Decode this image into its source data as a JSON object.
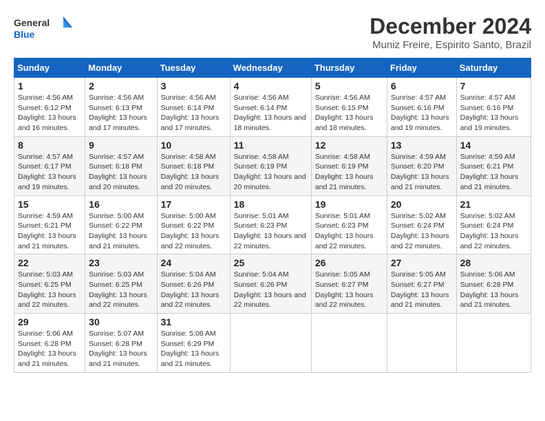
{
  "logo": {
    "line1": "General",
    "line2": "Blue"
  },
  "title": "December 2024",
  "subtitle": "Muniz Freire, Espirito Santo, Brazil",
  "days_of_week": [
    "Sunday",
    "Monday",
    "Tuesday",
    "Wednesday",
    "Thursday",
    "Friday",
    "Saturday"
  ],
  "weeks": [
    [
      {
        "day": "1",
        "sunrise": "4:56 AM",
        "sunset": "6:12 PM",
        "daylight": "13 hours and 16 minutes."
      },
      {
        "day": "2",
        "sunrise": "4:56 AM",
        "sunset": "6:13 PM",
        "daylight": "13 hours and 17 minutes."
      },
      {
        "day": "3",
        "sunrise": "4:56 AM",
        "sunset": "6:14 PM",
        "daylight": "13 hours and 17 minutes."
      },
      {
        "day": "4",
        "sunrise": "4:56 AM",
        "sunset": "6:14 PM",
        "daylight": "13 hours and 18 minutes."
      },
      {
        "day": "5",
        "sunrise": "4:56 AM",
        "sunset": "6:15 PM",
        "daylight": "13 hours and 18 minutes."
      },
      {
        "day": "6",
        "sunrise": "4:57 AM",
        "sunset": "6:16 PM",
        "daylight": "13 hours and 19 minutes."
      },
      {
        "day": "7",
        "sunrise": "4:57 AM",
        "sunset": "6:16 PM",
        "daylight": "13 hours and 19 minutes."
      }
    ],
    [
      {
        "day": "8",
        "sunrise": "4:57 AM",
        "sunset": "6:17 PM",
        "daylight": "13 hours and 19 minutes."
      },
      {
        "day": "9",
        "sunrise": "4:57 AM",
        "sunset": "6:18 PM",
        "daylight": "13 hours and 20 minutes."
      },
      {
        "day": "10",
        "sunrise": "4:58 AM",
        "sunset": "6:18 PM",
        "daylight": "13 hours and 20 minutes."
      },
      {
        "day": "11",
        "sunrise": "4:58 AM",
        "sunset": "6:19 PM",
        "daylight": "13 hours and 20 minutes."
      },
      {
        "day": "12",
        "sunrise": "4:58 AM",
        "sunset": "6:19 PM",
        "daylight": "13 hours and 21 minutes."
      },
      {
        "day": "13",
        "sunrise": "4:59 AM",
        "sunset": "6:20 PM",
        "daylight": "13 hours and 21 minutes."
      },
      {
        "day": "14",
        "sunrise": "4:59 AM",
        "sunset": "6:21 PM",
        "daylight": "13 hours and 21 minutes."
      }
    ],
    [
      {
        "day": "15",
        "sunrise": "4:59 AM",
        "sunset": "6:21 PM",
        "daylight": "13 hours and 21 minutes."
      },
      {
        "day": "16",
        "sunrise": "5:00 AM",
        "sunset": "6:22 PM",
        "daylight": "13 hours and 21 minutes."
      },
      {
        "day": "17",
        "sunrise": "5:00 AM",
        "sunset": "6:22 PM",
        "daylight": "13 hours and 22 minutes."
      },
      {
        "day": "18",
        "sunrise": "5:01 AM",
        "sunset": "6:23 PM",
        "daylight": "13 hours and 22 minutes."
      },
      {
        "day": "19",
        "sunrise": "5:01 AM",
        "sunset": "6:23 PM",
        "daylight": "13 hours and 22 minutes."
      },
      {
        "day": "20",
        "sunrise": "5:02 AM",
        "sunset": "6:24 PM",
        "daylight": "13 hours and 22 minutes."
      },
      {
        "day": "21",
        "sunrise": "5:02 AM",
        "sunset": "6:24 PM",
        "daylight": "13 hours and 22 minutes."
      }
    ],
    [
      {
        "day": "22",
        "sunrise": "5:03 AM",
        "sunset": "6:25 PM",
        "daylight": "13 hours and 22 minutes."
      },
      {
        "day": "23",
        "sunrise": "5:03 AM",
        "sunset": "6:25 PM",
        "daylight": "13 hours and 22 minutes."
      },
      {
        "day": "24",
        "sunrise": "5:04 AM",
        "sunset": "6:26 PM",
        "daylight": "13 hours and 22 minutes."
      },
      {
        "day": "25",
        "sunrise": "5:04 AM",
        "sunset": "6:26 PM",
        "daylight": "13 hours and 22 minutes."
      },
      {
        "day": "26",
        "sunrise": "5:05 AM",
        "sunset": "6:27 PM",
        "daylight": "13 hours and 22 minutes."
      },
      {
        "day": "27",
        "sunrise": "5:05 AM",
        "sunset": "6:27 PM",
        "daylight": "13 hours and 21 minutes."
      },
      {
        "day": "28",
        "sunrise": "5:06 AM",
        "sunset": "6:28 PM",
        "daylight": "13 hours and 21 minutes."
      }
    ],
    [
      {
        "day": "29",
        "sunrise": "5:06 AM",
        "sunset": "6:28 PM",
        "daylight": "13 hours and 21 minutes."
      },
      {
        "day": "30",
        "sunrise": "5:07 AM",
        "sunset": "6:28 PM",
        "daylight": "13 hours and 21 minutes."
      },
      {
        "day": "31",
        "sunrise": "5:08 AM",
        "sunset": "6:29 PM",
        "daylight": "13 hours and 21 minutes."
      },
      null,
      null,
      null,
      null
    ]
  ],
  "labels": {
    "sunrise": "Sunrise:",
    "sunset": "Sunset:",
    "daylight": "Daylight:"
  }
}
